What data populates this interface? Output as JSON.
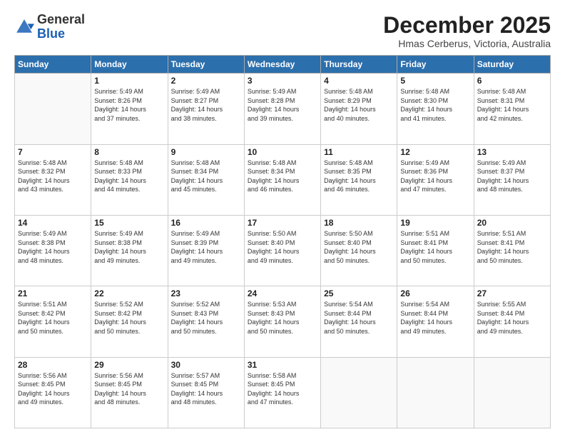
{
  "logo": {
    "general": "General",
    "blue": "Blue",
    "icon_color": "#1a5fb4"
  },
  "title": "December 2025",
  "subtitle": "Hmas Cerberus, Victoria, Australia",
  "days_header": [
    "Sunday",
    "Monday",
    "Tuesday",
    "Wednesday",
    "Thursday",
    "Friday",
    "Saturday"
  ],
  "weeks": [
    [
      {
        "num": "",
        "info": ""
      },
      {
        "num": "1",
        "info": "Sunrise: 5:49 AM\nSunset: 8:26 PM\nDaylight: 14 hours\nand 37 minutes."
      },
      {
        "num": "2",
        "info": "Sunrise: 5:49 AM\nSunset: 8:27 PM\nDaylight: 14 hours\nand 38 minutes."
      },
      {
        "num": "3",
        "info": "Sunrise: 5:49 AM\nSunset: 8:28 PM\nDaylight: 14 hours\nand 39 minutes."
      },
      {
        "num": "4",
        "info": "Sunrise: 5:48 AM\nSunset: 8:29 PM\nDaylight: 14 hours\nand 40 minutes."
      },
      {
        "num": "5",
        "info": "Sunrise: 5:48 AM\nSunset: 8:30 PM\nDaylight: 14 hours\nand 41 minutes."
      },
      {
        "num": "6",
        "info": "Sunrise: 5:48 AM\nSunset: 8:31 PM\nDaylight: 14 hours\nand 42 minutes."
      }
    ],
    [
      {
        "num": "7",
        "info": "Sunrise: 5:48 AM\nSunset: 8:32 PM\nDaylight: 14 hours\nand 43 minutes."
      },
      {
        "num": "8",
        "info": "Sunrise: 5:48 AM\nSunset: 8:33 PM\nDaylight: 14 hours\nand 44 minutes."
      },
      {
        "num": "9",
        "info": "Sunrise: 5:48 AM\nSunset: 8:34 PM\nDaylight: 14 hours\nand 45 minutes."
      },
      {
        "num": "10",
        "info": "Sunrise: 5:48 AM\nSunset: 8:34 PM\nDaylight: 14 hours\nand 46 minutes."
      },
      {
        "num": "11",
        "info": "Sunrise: 5:48 AM\nSunset: 8:35 PM\nDaylight: 14 hours\nand 46 minutes."
      },
      {
        "num": "12",
        "info": "Sunrise: 5:49 AM\nSunset: 8:36 PM\nDaylight: 14 hours\nand 47 minutes."
      },
      {
        "num": "13",
        "info": "Sunrise: 5:49 AM\nSunset: 8:37 PM\nDaylight: 14 hours\nand 48 minutes."
      }
    ],
    [
      {
        "num": "14",
        "info": "Sunrise: 5:49 AM\nSunset: 8:38 PM\nDaylight: 14 hours\nand 48 minutes."
      },
      {
        "num": "15",
        "info": "Sunrise: 5:49 AM\nSunset: 8:38 PM\nDaylight: 14 hours\nand 49 minutes."
      },
      {
        "num": "16",
        "info": "Sunrise: 5:49 AM\nSunset: 8:39 PM\nDaylight: 14 hours\nand 49 minutes."
      },
      {
        "num": "17",
        "info": "Sunrise: 5:50 AM\nSunset: 8:40 PM\nDaylight: 14 hours\nand 49 minutes."
      },
      {
        "num": "18",
        "info": "Sunrise: 5:50 AM\nSunset: 8:40 PM\nDaylight: 14 hours\nand 50 minutes."
      },
      {
        "num": "19",
        "info": "Sunrise: 5:51 AM\nSunset: 8:41 PM\nDaylight: 14 hours\nand 50 minutes."
      },
      {
        "num": "20",
        "info": "Sunrise: 5:51 AM\nSunset: 8:41 PM\nDaylight: 14 hours\nand 50 minutes."
      }
    ],
    [
      {
        "num": "21",
        "info": "Sunrise: 5:51 AM\nSunset: 8:42 PM\nDaylight: 14 hours\nand 50 minutes."
      },
      {
        "num": "22",
        "info": "Sunrise: 5:52 AM\nSunset: 8:42 PM\nDaylight: 14 hours\nand 50 minutes."
      },
      {
        "num": "23",
        "info": "Sunrise: 5:52 AM\nSunset: 8:43 PM\nDaylight: 14 hours\nand 50 minutes."
      },
      {
        "num": "24",
        "info": "Sunrise: 5:53 AM\nSunset: 8:43 PM\nDaylight: 14 hours\nand 50 minutes."
      },
      {
        "num": "25",
        "info": "Sunrise: 5:54 AM\nSunset: 8:44 PM\nDaylight: 14 hours\nand 50 minutes."
      },
      {
        "num": "26",
        "info": "Sunrise: 5:54 AM\nSunset: 8:44 PM\nDaylight: 14 hours\nand 49 minutes."
      },
      {
        "num": "27",
        "info": "Sunrise: 5:55 AM\nSunset: 8:44 PM\nDaylight: 14 hours\nand 49 minutes."
      }
    ],
    [
      {
        "num": "28",
        "info": "Sunrise: 5:56 AM\nSunset: 8:45 PM\nDaylight: 14 hours\nand 49 minutes."
      },
      {
        "num": "29",
        "info": "Sunrise: 5:56 AM\nSunset: 8:45 PM\nDaylight: 14 hours\nand 48 minutes."
      },
      {
        "num": "30",
        "info": "Sunrise: 5:57 AM\nSunset: 8:45 PM\nDaylight: 14 hours\nand 48 minutes."
      },
      {
        "num": "31",
        "info": "Sunrise: 5:58 AM\nSunset: 8:45 PM\nDaylight: 14 hours\nand 47 minutes."
      },
      {
        "num": "",
        "info": ""
      },
      {
        "num": "",
        "info": ""
      },
      {
        "num": "",
        "info": ""
      }
    ]
  ]
}
